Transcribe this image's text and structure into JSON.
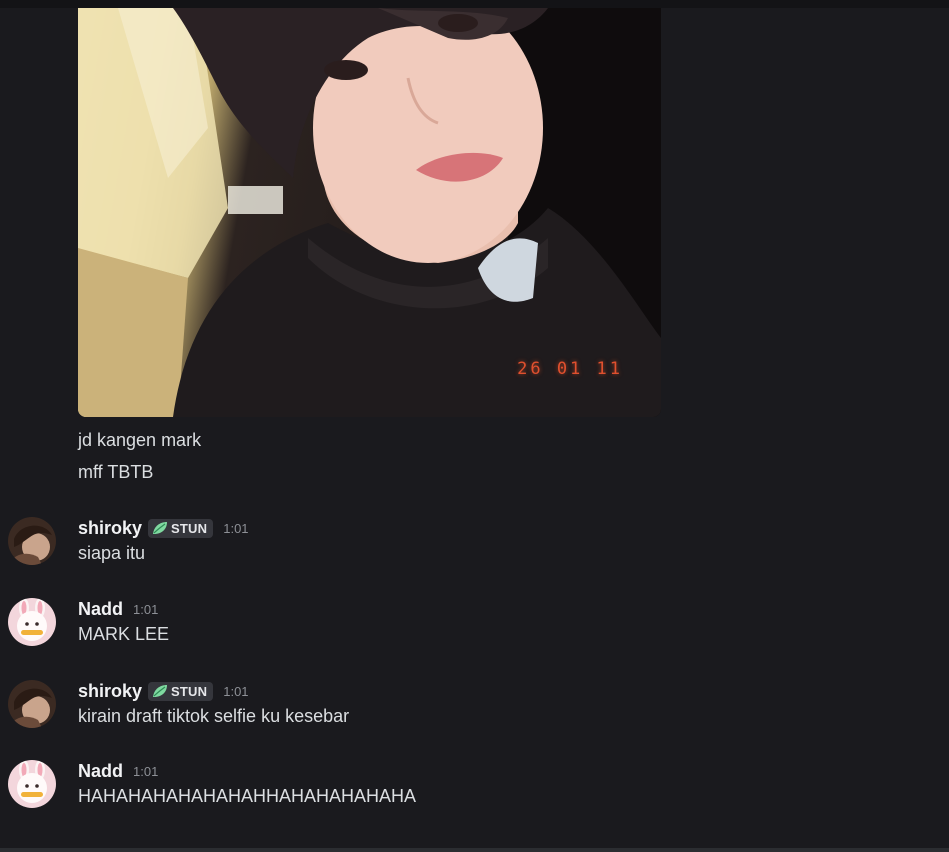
{
  "attachment": {
    "stamp_text": "26 01 11"
  },
  "lines": [
    "jd kangen mark",
    "mff TBTB"
  ],
  "tag_text": "STUN",
  "messages": [
    {
      "author": "shiroky",
      "has_tag": true,
      "time": "1:01",
      "text": "siapa itu"
    },
    {
      "author": "Nadd",
      "has_tag": false,
      "time": "1:01",
      "text": "MARK LEE"
    },
    {
      "author": "shiroky",
      "has_tag": true,
      "time": "1:01",
      "text": "kirain draft tiktok selfie ku kesebar"
    },
    {
      "author": "Nadd",
      "has_tag": false,
      "time": "1:01",
      "text": "HAHAHAHAHAHAHAHHAHAHAHAHAHA"
    }
  ],
  "colors": {
    "background": "#1a1a1e",
    "username": "#f2f3f5",
    "message_text": "#dbdee1",
    "timestamp": "#8d9096",
    "tag_bg": "#35363c",
    "stamp": "#e0502e"
  }
}
